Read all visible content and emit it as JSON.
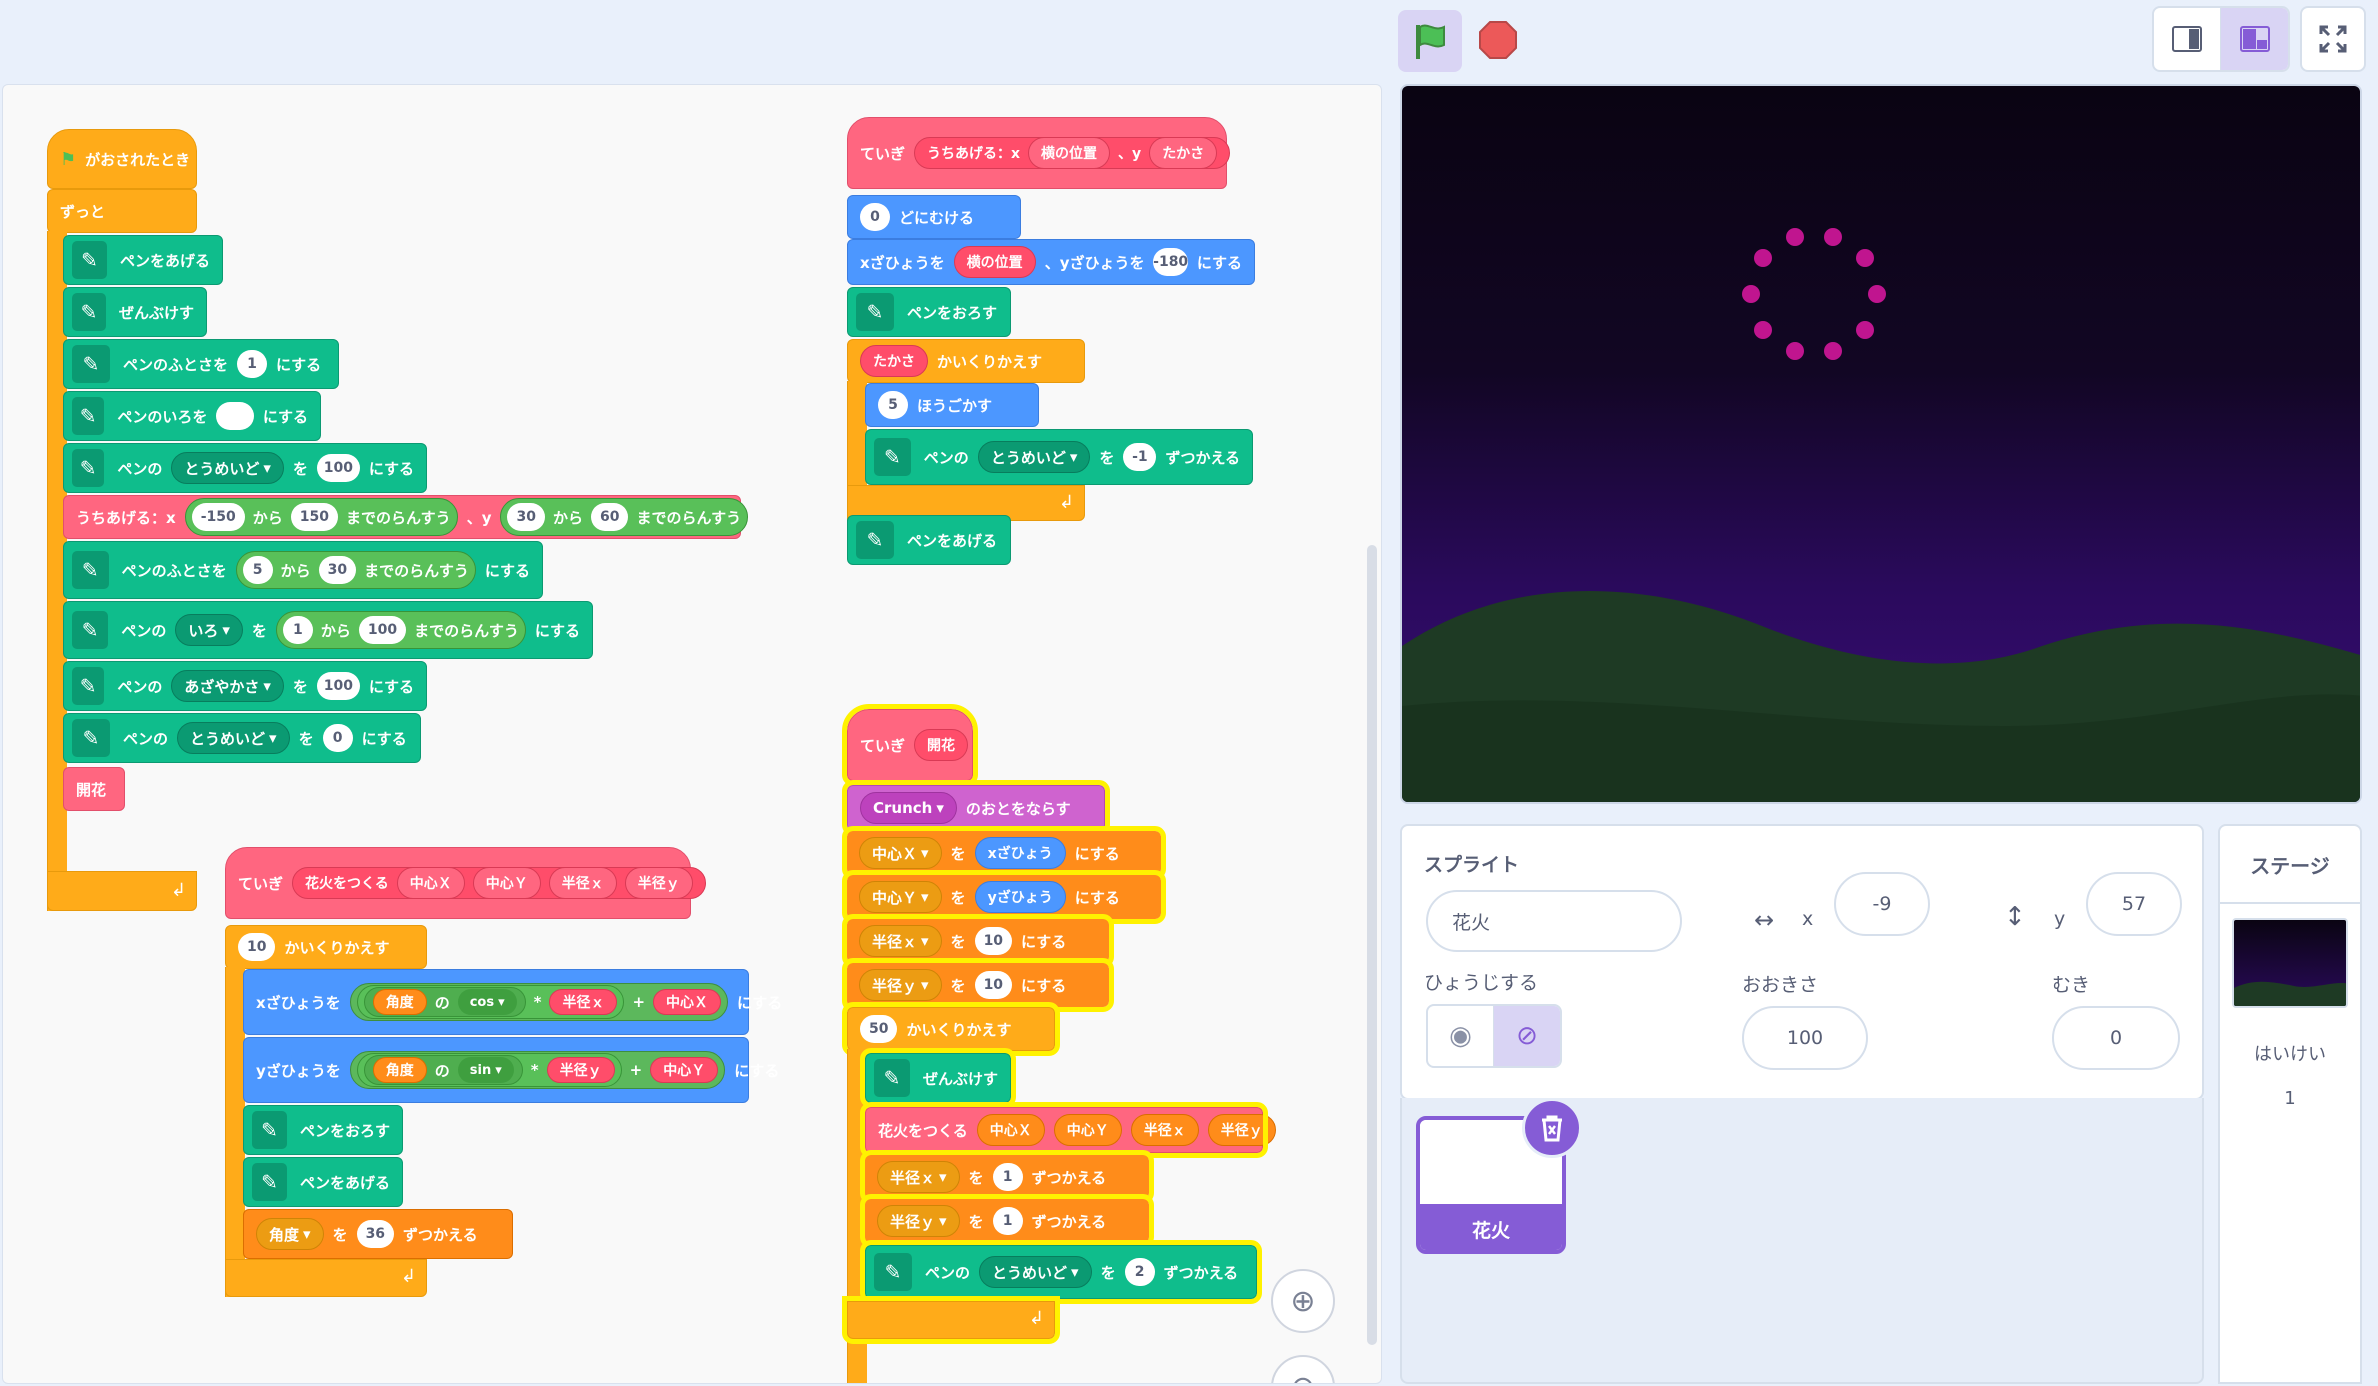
{
  "toolbar": {
    "flag_icon": "green-flag-icon",
    "stop_icon": "stop-icon",
    "layout_small": "small-stage-icon",
    "layout_normal": "normal-stage-icon",
    "fullscreen": "fullscreen-icon"
  },
  "script_main": {
    "hat": "がおされたとき",
    "forever": "ずっと",
    "pen_up": "ペンをあげる",
    "clear": "ぜんぶけす",
    "set_size_a": "ペンのふとさを",
    "set_size_v": "1",
    "set_size_b": "にする",
    "set_color_a": "ペンのいろを",
    "set_color_b": "にする",
    "pen_of": "ペンの",
    "transparency": "とうめいど",
    "wo": "を",
    "v100": "100",
    "nisuru": "にする",
    "launch": "うちあげる：x",
    "lx1": "-150",
    "kara": "から",
    "lx2": "150",
    "rand": "までのらんすう",
    "comma_y": "、y",
    "ly1": "30",
    "ly2": "60",
    "size_r1": "5",
    "size_r2": "30",
    "color": "いろ",
    "c1": "1",
    "c2": "100",
    "saturation": "あざやかさ",
    "zero": "0",
    "bloom": "開花"
  },
  "script_launch": {
    "define": "ていぎ",
    "name": "うちあげる：x",
    "arg_x": "横の位置",
    "comma_y": "、y",
    "arg_y": "たかさ",
    "dir_v": "0",
    "dir": "どにむける",
    "setx_a": "xざひょうを",
    "setx_arg": "横の位置",
    "sety_a": "、yざひょうを",
    "sety_v": "-180",
    "setx_b": "にする",
    "pen_down": "ペンをおろす",
    "rep_arg": "たかさ",
    "repeat": "かいくりかえす",
    "move_v": "5",
    "move": "ほうごかす",
    "pen_of": "ペンの",
    "transparency": "とうめいど",
    "wo": "を",
    "chg_v": "-1",
    "change": "ずつかえる",
    "pen_up": "ペンをあげる"
  },
  "script_firework": {
    "define": "ていぎ",
    "name": "花火をつくる",
    "a1": "中心Ｘ",
    "a2": "中心Ｙ",
    "a3": "半径ｘ",
    "a4": "半径ｙ",
    "rep_v": "10",
    "repeat": "かいくりかえす",
    "setx": "xざひょうを",
    "sety": "yざひょうを",
    "angle": "角度",
    "of": "の",
    "cos": "cos",
    "sin": "sin",
    "times": "*",
    "plus": "+",
    "nisuru": "にする",
    "pen_down": "ペンをおろす",
    "pen_up": "ペンをあげる",
    "wo": "を",
    "ang_v": "36",
    "change": "ずつかえる"
  },
  "script_bloom": {
    "define": "ていぎ",
    "name": "開花",
    "sound": "Crunch",
    "play": "のおとをならす",
    "cx": "中心Ｘ",
    "cy": "中心Ｙ",
    "wo": "を",
    "xpos": "xざひょう",
    "ypos": "yざひょう",
    "nisuru": "にする",
    "rx": "半径ｘ",
    "ry": "半径ｙ",
    "v10": "10",
    "rep_v": "50",
    "repeat": "かいくりかえす",
    "clear": "ぜんぶけす",
    "make": "花火をつくる",
    "v1": "1",
    "change": "ずつかえる",
    "pen_of": "ペンの",
    "transparency": "とうめいど",
    "v2": "2"
  },
  "sprite": {
    "title": "スプライト",
    "name": "花火",
    "x_label": "x",
    "x": "-9",
    "y_label": "y",
    "y": "57",
    "show": "ひょうじする",
    "size_label": "おおきさ",
    "size": "100",
    "dir_label": "むき",
    "dir": "0"
  },
  "sprite_tile": {
    "name": "花火"
  },
  "stage_panel": {
    "title": "ステージ",
    "backdrop": "はいけい",
    "count": "1"
  },
  "colors": {
    "control": "#ffab19",
    "pen": "#0fbd8c",
    "motion": "#4c97ff",
    "myblocks": "#ff6680",
    "sound": "#cf63cf",
    "accent": "#855cd6",
    "firework": "#c0158f"
  }
}
